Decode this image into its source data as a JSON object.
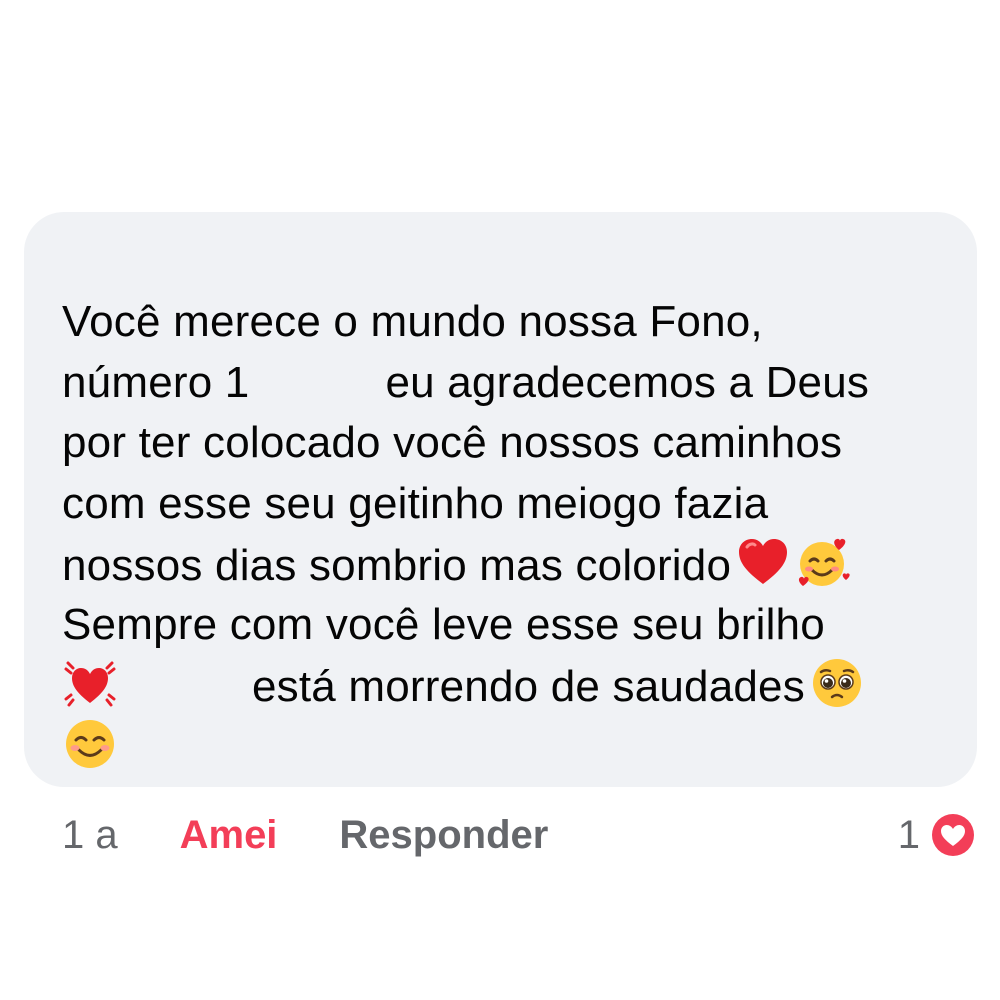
{
  "comment": {
    "lines": [
      "Você merece o mundo nossa Fono,",
      "número 1",
      "eu agradecemos a Deus",
      "por ter colocado você nossos caminhos",
      "com esse seu geitinho meiogo fazia",
      "nossos dias sombrio mas colorido",
      "Sempre com você leve esse seu brilho",
      "está morrendo de saudades"
    ],
    "emoji_icons": [
      "red-heart-icon",
      "smiling-face-with-hearts-icon",
      "beating-heart-icon",
      "pleading-face-icon",
      "smiling-face-icon"
    ]
  },
  "actions": {
    "time": "1 a",
    "reaction_label": "Amei",
    "reply_label": "Responder"
  },
  "reactions": {
    "count": "1",
    "icon": "love-reaction-icon"
  },
  "colors": {
    "bubble_bg": "#f0f2f5",
    "text": "#050505",
    "secondary": "#65676b",
    "love": "#f33e58"
  }
}
